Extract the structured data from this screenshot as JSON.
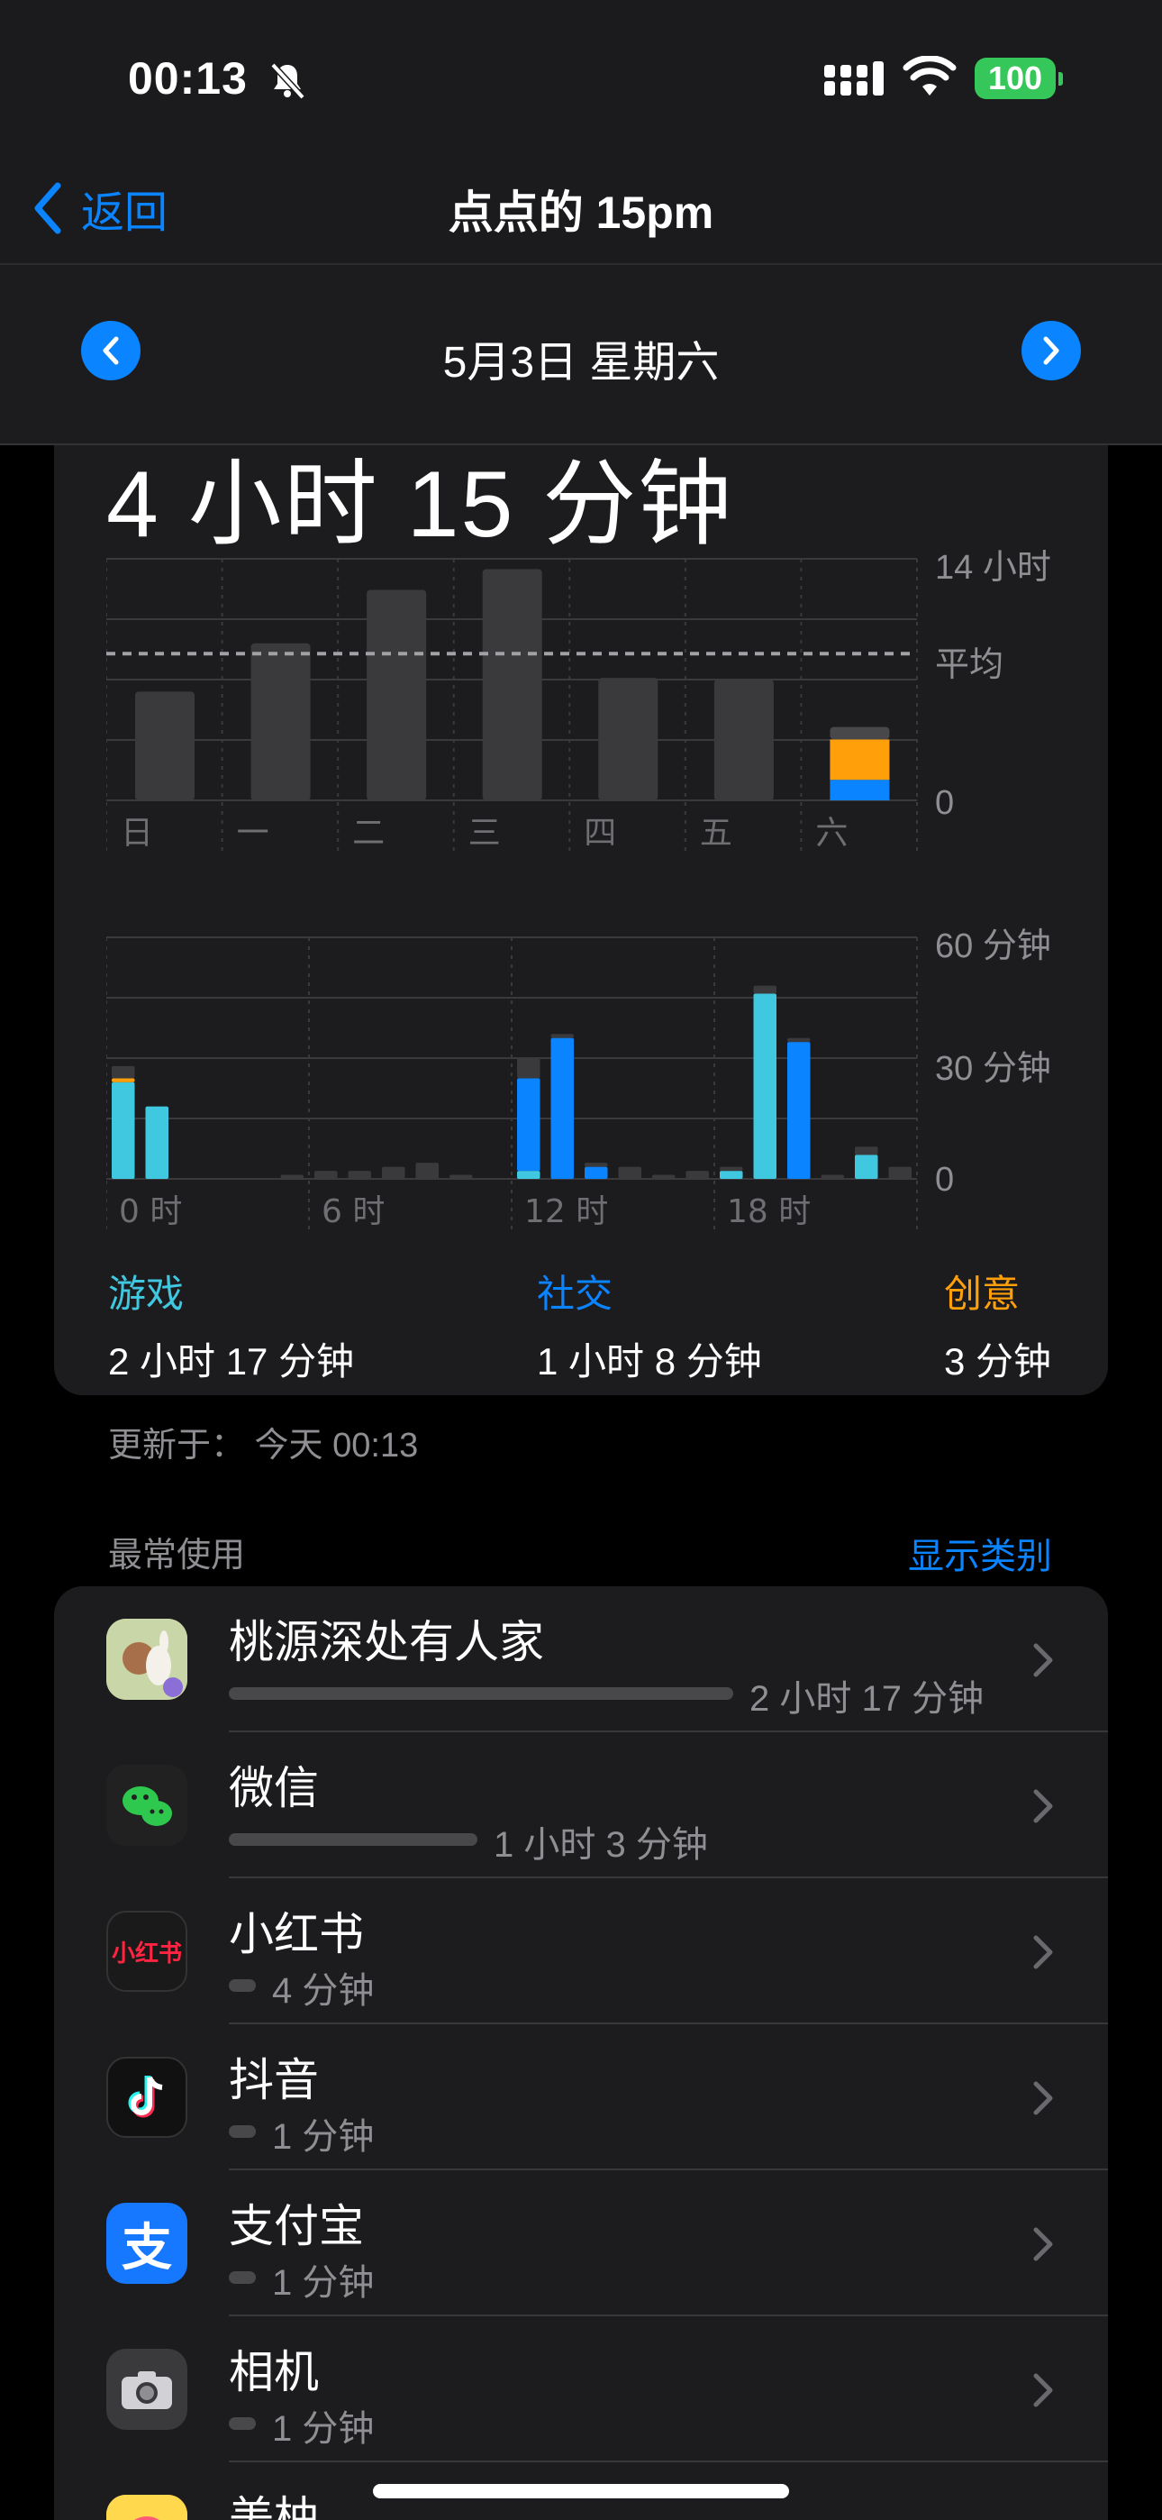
{
  "status": {
    "time": "00:13",
    "battery": "100"
  },
  "nav": {
    "back_label": "返回",
    "title": "点点的 15pm"
  },
  "date": {
    "label": "5月3日 星期六"
  },
  "summary": {
    "total": "4 小时 15 分钟"
  },
  "week_chart": {
    "type": "bar",
    "categories": [
      "日",
      "一",
      "二",
      "三",
      "四",
      "五",
      "六"
    ],
    "y_label_top": "14 小时",
    "y_label_avg": "平均",
    "y_label_zero": "0",
    "values_hours": [
      6.3,
      9.1,
      12.2,
      13.4,
      7.1,
      7.0,
      4.25
    ],
    "average_hours": 8.5,
    "ylim": [
      0,
      14
    ]
  },
  "hour_chart": {
    "type": "bar",
    "x_labels": [
      "0 时",
      "6 时",
      "12 时",
      "18 时"
    ],
    "y_labels": [
      "60 分钟",
      "30 分钟",
      "0"
    ],
    "ylim": [
      0,
      60
    ],
    "series": [
      {
        "key": "games",
        "color": "#40c8e0",
        "values": [
          24,
          18,
          0,
          0,
          0,
          0,
          0,
          0,
          0,
          0,
          0,
          0,
          2,
          0,
          0,
          0,
          0,
          0,
          2,
          46,
          0,
          0,
          6,
          0
        ]
      },
      {
        "key": "social",
        "color": "#0a84ff",
        "values": [
          0,
          0,
          0,
          0,
          0,
          0,
          0,
          0,
          0,
          0,
          0,
          0,
          23,
          35,
          3,
          0,
          0,
          0,
          0,
          0,
          34,
          0,
          0,
          0
        ]
      },
      {
        "key": "creativity",
        "color": "#ff9f0a",
        "values": [
          1,
          0,
          0,
          0,
          0,
          0,
          0,
          0,
          0,
          0,
          0,
          0,
          0,
          0,
          0,
          0,
          0,
          0,
          0,
          0,
          0,
          0,
          0,
          0
        ]
      },
      {
        "key": "other",
        "color": "#3a3a3c",
        "values": [
          3,
          0,
          0,
          0,
          0,
          1,
          2,
          2,
          3,
          4,
          1,
          0,
          5,
          1,
          1,
          3,
          1,
          2,
          1,
          2,
          1,
          1,
          2,
          3
        ]
      }
    ]
  },
  "categories": [
    {
      "name": "游戏",
      "time": "2 小时 17 分钟",
      "color": "#40c8e0"
    },
    {
      "name": "社交",
      "time": "1 小时 8 分钟",
      "color": "#0a84ff"
    },
    {
      "name": "创意",
      "time": "3 分钟",
      "color": "#ff9f0a"
    }
  ],
  "updated": "更新于： 今天 00:13",
  "most_used": {
    "title": "最常使用",
    "show_categories": "显示类别"
  },
  "apps": [
    {
      "name": "桃源深处有人家",
      "duration": "2 小时 17 分钟",
      "share": 1.0,
      "icon": "peach-garden-icon"
    },
    {
      "name": "微信",
      "duration": "1 小时 3 分钟",
      "share": 0.49,
      "icon": "wechat-icon"
    },
    {
      "name": "小红书",
      "duration": "4 分钟",
      "share": 0.05,
      "icon": "xiaohongshu-icon",
      "icon_text": "小红书"
    },
    {
      "name": "抖音",
      "duration": "1 分钟",
      "share": 0.05,
      "icon": "douyin-icon"
    },
    {
      "name": "支付宝",
      "duration": "1 分钟",
      "share": 0.05,
      "icon": "alipay-icon",
      "icon_text": "支"
    },
    {
      "name": "相机",
      "duration": "1 分钟",
      "share": 0.05,
      "icon": "camera-icon"
    },
    {
      "name": "美柚",
      "duration": "",
      "share": 0,
      "icon": "meiyou-icon"
    }
  ]
}
